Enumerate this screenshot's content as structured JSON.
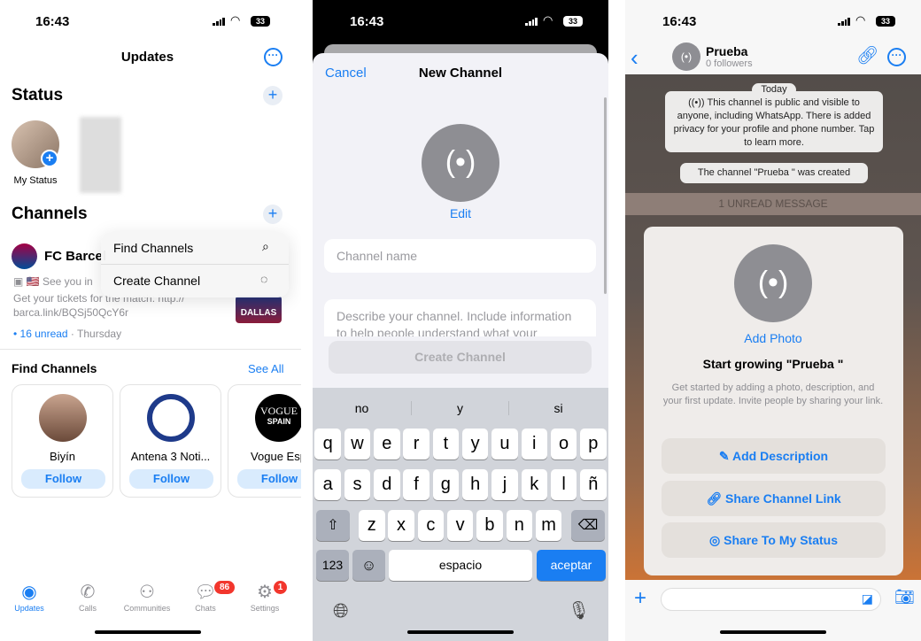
{
  "status_bar": {
    "time": "16:43",
    "battery": "33"
  },
  "updates": {
    "title": "Updates",
    "status_heading": "Status",
    "my_status_label": "My Status",
    "channels_heading": "Channels",
    "channel": {
      "name": "FC Barcel",
      "preview_line1": "See you in",
      "preview_line2": "Get your tickets for the match: http://",
      "preview_line3": "barca.link/BQSj50QcY6r",
      "unread": "16 unread",
      "day": "Thursday",
      "thumb_text": "DALLAS"
    },
    "menu": {
      "items": [
        {
          "label": "Find Channels",
          "icon": "search-icon"
        },
        {
          "label": "Create Channel",
          "icon": "create-channel-icon"
        }
      ]
    },
    "find_heading": "Find Channels",
    "see_all": "See All",
    "suggestions": [
      {
        "name": "Biyín",
        "follow": "Follow"
      },
      {
        "name": "Antena 3 Noti...",
        "follow": "Follow"
      },
      {
        "name": "Vogue Esp",
        "follow": "Follow",
        "logo": "VOGUE",
        "logo_sub": "SPAIN"
      }
    ],
    "tabs": [
      {
        "label": "Updates",
        "active": true
      },
      {
        "label": "Calls"
      },
      {
        "label": "Communities"
      },
      {
        "label": "Chats",
        "badge": "86"
      },
      {
        "label": "Settings",
        "badge": "1"
      }
    ]
  },
  "new_channel": {
    "cancel": "Cancel",
    "title": "New Channel",
    "edit": "Edit",
    "name_placeholder": "Channel name",
    "desc_placeholder": "Describe your channel. Include information to help people understand what your",
    "create": "Create Channel",
    "suggestions": [
      "no",
      "y",
      "si"
    ],
    "rows": [
      [
        "q",
        "w",
        "e",
        "r",
        "t",
        "y",
        "u",
        "i",
        "o",
        "p"
      ],
      [
        "a",
        "s",
        "d",
        "f",
        "g",
        "h",
        "j",
        "k",
        "l",
        "ñ"
      ],
      [
        "z",
        "x",
        "c",
        "v",
        "b",
        "n",
        "m"
      ]
    ],
    "numbers_key": "123",
    "space": "espacio",
    "accept": "aceptar"
  },
  "channel_view": {
    "name": "Prueba",
    "followers": "0 followers",
    "today": "Today",
    "info": "This channel is public and visible to anyone, including WhatsApp. There is added privacy for your profile and phone number. Tap to learn more.",
    "created": "The channel \"Prueba \" was created",
    "unread": "1 UNREAD MESSAGE",
    "add_photo": "Add Photo",
    "growing_title": "Start growing \"Prueba \"",
    "growing_desc": "Get started by adding a photo, description, and your first update. Invite people by sharing your link.",
    "buttons": [
      "Add Description",
      "Share Channel Link",
      "Share To My Status"
    ]
  },
  "colors": {
    "accent": "#1a7ef2",
    "badge": "#f2362d"
  }
}
